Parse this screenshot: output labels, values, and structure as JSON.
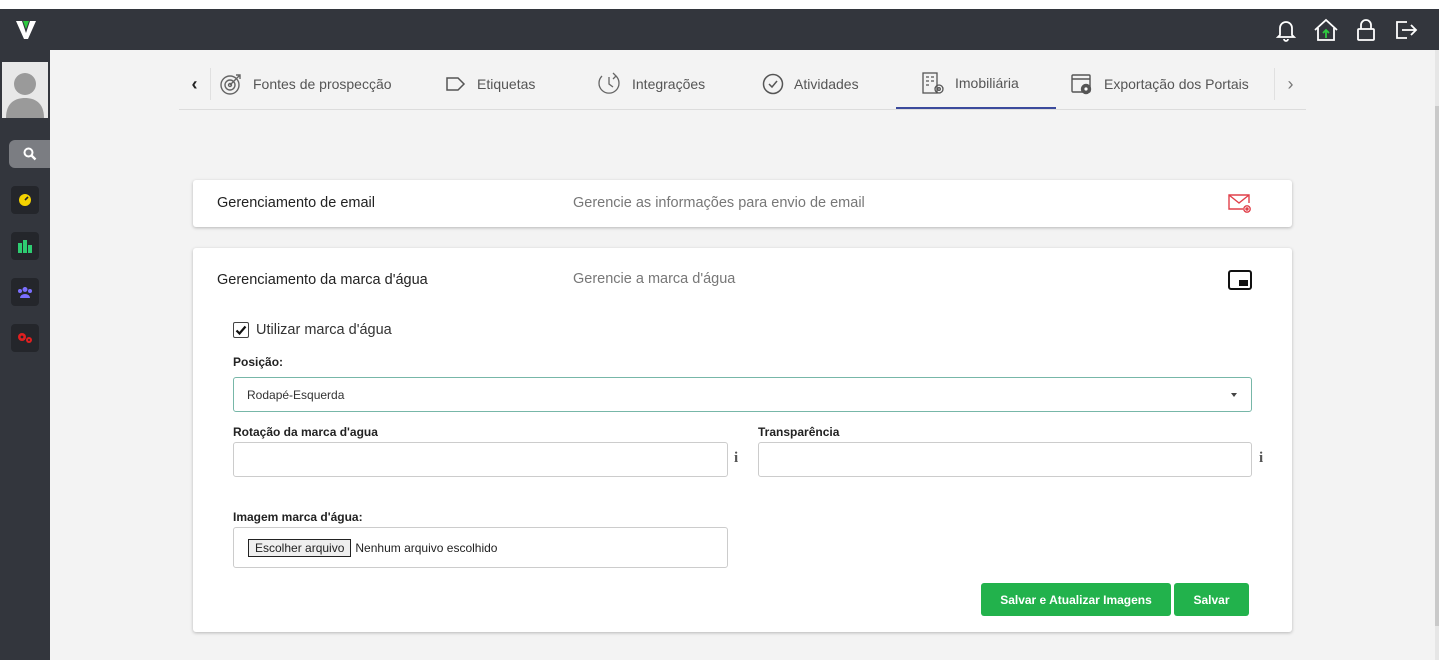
{
  "tabs": [
    {
      "label": "Fontes de prospecção",
      "icon": "target-icon"
    },
    {
      "label": "Etiquetas",
      "icon": "tag-icon"
    },
    {
      "label": "Integrações",
      "icon": "sync-icon"
    },
    {
      "label": "Atividades",
      "icon": "check-circle-icon"
    },
    {
      "label": "Imobiliária",
      "icon": "building-gear-icon",
      "active": true
    },
    {
      "label": "Exportação dos Portais",
      "icon": "window-gear-icon"
    }
  ],
  "email_card": {
    "title": "Gerenciamento de email",
    "description": "Gerencie as informações para envio de email"
  },
  "watermark_card": {
    "title": "Gerenciamento da marca d'água",
    "description": "Gerencie a marca d'água",
    "use_watermark_label": "Utilizar marca d'água",
    "use_watermark_checked": true,
    "position_label": "Posição:",
    "position_value": "Rodapé-Esquerda",
    "rotation_label": "Rotação da marca d'agua",
    "rotation_value": "",
    "transparency_label": "Transparência",
    "transparency_value": "",
    "info_glyph": "i",
    "image_label": "Imagem marca d'água:",
    "choose_file_label": "Escolher arquivo",
    "no_file_text": "Nenhum arquivo escolhido",
    "save_update_label": "Salvar e Atualizar Imagens",
    "save_label": "Salvar"
  },
  "colors": {
    "topbar": "#33363d",
    "accent_green": "#22b24c",
    "active_tab_underline": "#3b4a9c",
    "email_icon": "#e0404a"
  }
}
